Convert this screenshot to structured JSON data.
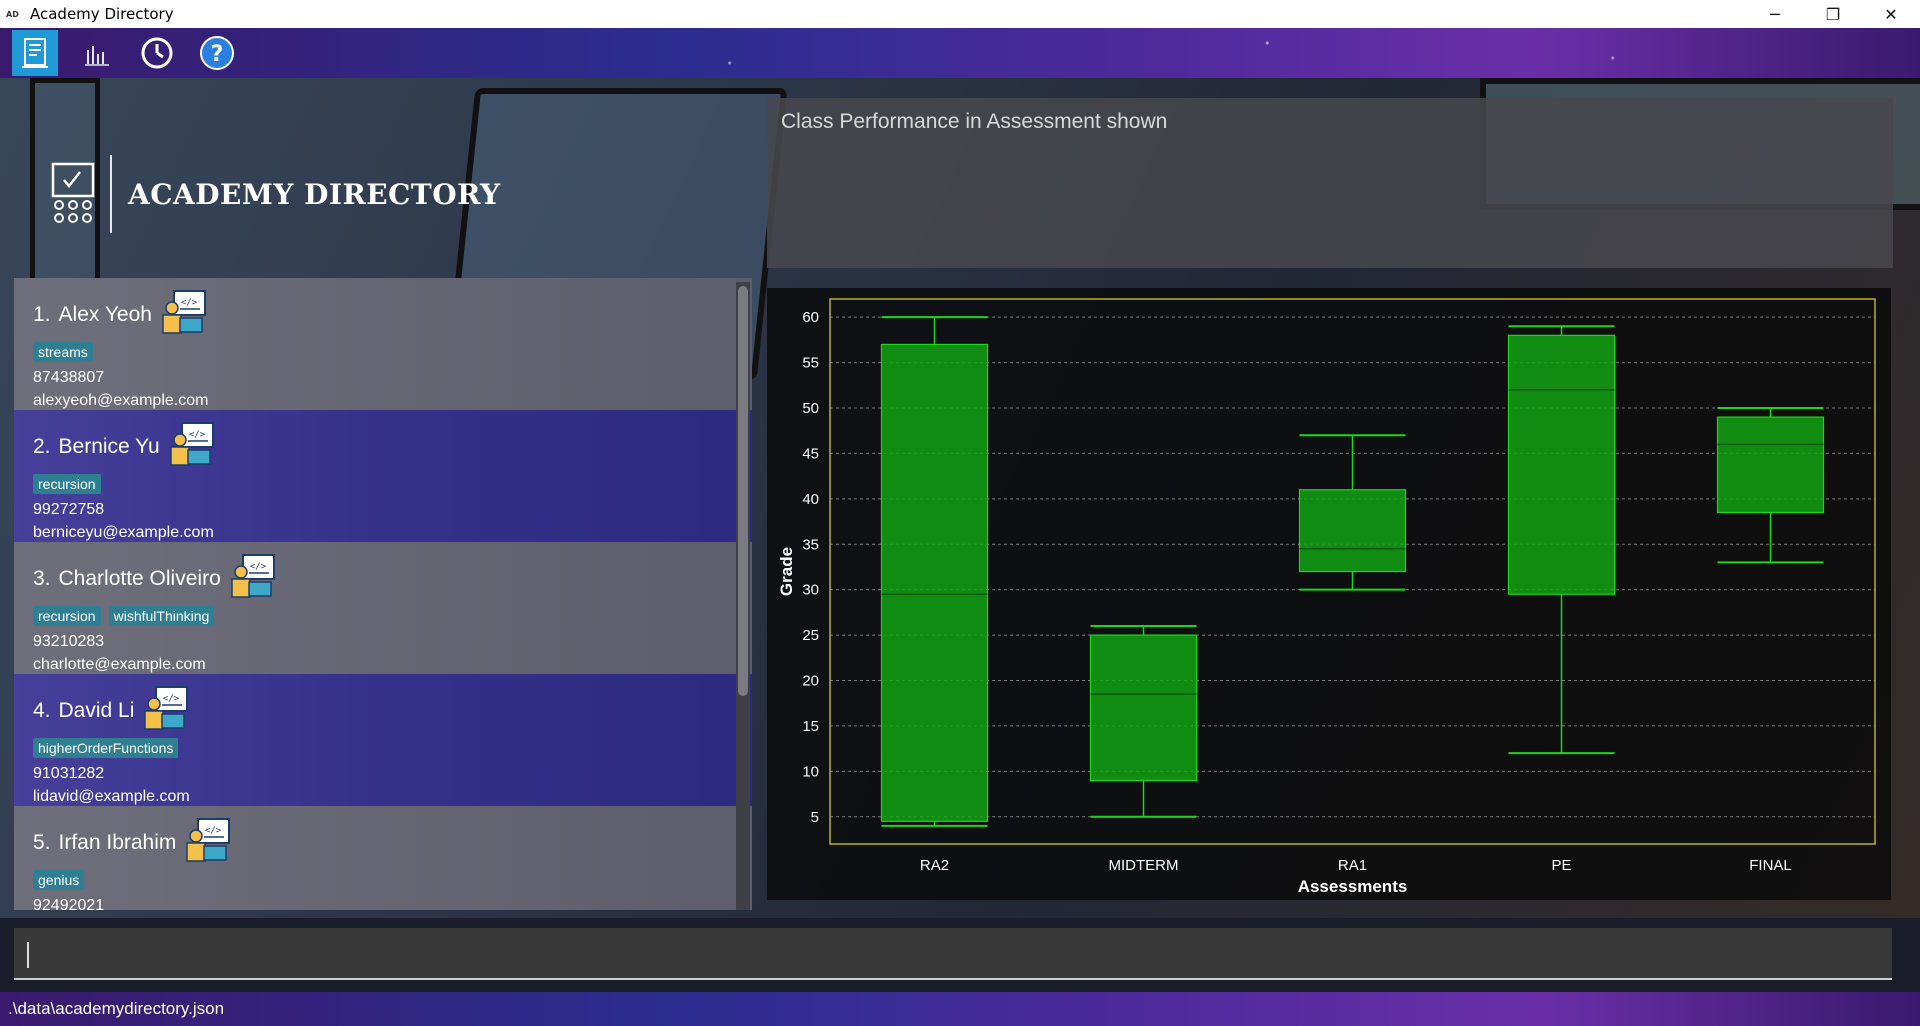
{
  "window": {
    "title": "Academy Directory",
    "app_icon_text": "AD",
    "minimize": "─",
    "maximize": "❐",
    "close": "✕"
  },
  "toolbar": {
    "buttons": [
      {
        "name": "directory-view-icon",
        "active": true
      },
      {
        "name": "chart-icon",
        "active": false
      },
      {
        "name": "history-icon",
        "active": false
      },
      {
        "name": "help-icon",
        "active": false
      }
    ]
  },
  "brand": {
    "name": "ACADEMY DIRECTORY"
  },
  "students": [
    {
      "index": "1.",
      "name": "Alex Yeoh",
      "tags": [
        "streams"
      ],
      "phone": "87438807",
      "email": "alexyeoh@example.com"
    },
    {
      "index": "2.",
      "name": "Bernice Yu",
      "tags": [
        "recursion"
      ],
      "phone": "99272758",
      "email": "berniceyu@example.com"
    },
    {
      "index": "3.",
      "name": "Charlotte Oliveiro",
      "tags": [
        "recursion",
        "wishfulThinking"
      ],
      "phone": "93210283",
      "email": "charlotte@example.com"
    },
    {
      "index": "4.",
      "name": "David Li",
      "tags": [
        "higherOrderFunctions"
      ],
      "phone": "91031282",
      "email": "lidavid@example.com"
    },
    {
      "index": "5.",
      "name": "Irfan Ibrahim",
      "tags": [
        "genius"
      ],
      "phone": "92492021",
      "email": ""
    }
  ],
  "result": {
    "text": "Class Performance in Assessment shown"
  },
  "command": {
    "value": ""
  },
  "status": {
    "path": ".\\data\\academydirectory.json"
  },
  "colors": {
    "box_fill": "#12a812",
    "box_stroke": "#19d819",
    "frame": "#b5b52a",
    "grid": "#9a9a9a"
  },
  "chart_data": {
    "type": "boxplot",
    "xlabel": "Assessments",
    "ylabel": "Grade",
    "ylim": [
      2,
      62
    ],
    "yticks": [
      5,
      10,
      15,
      20,
      25,
      30,
      35,
      40,
      45,
      50,
      55,
      60
    ],
    "grid": true,
    "categories": [
      "RA2",
      "MIDTERM",
      "RA1",
      "PE",
      "FINAL"
    ],
    "boxes": [
      {
        "category": "RA2",
        "min": 4,
        "q1": 4.5,
        "median": 29.5,
        "q3": 57,
        "max": 60
      },
      {
        "category": "MIDTERM",
        "min": 5,
        "q1": 9,
        "median": 18.5,
        "q3": 25,
        "max": 26
      },
      {
        "category": "RA1",
        "min": 30,
        "q1": 32,
        "median": 34.5,
        "q3": 41,
        "max": 47
      },
      {
        "category": "PE",
        "min": 12,
        "q1": 29.5,
        "median": 52,
        "q3": 58,
        "max": 59
      },
      {
        "category": "FINAL",
        "min": 33,
        "q1": 38.5,
        "median": 46,
        "q3": 49,
        "max": 50
      }
    ]
  }
}
